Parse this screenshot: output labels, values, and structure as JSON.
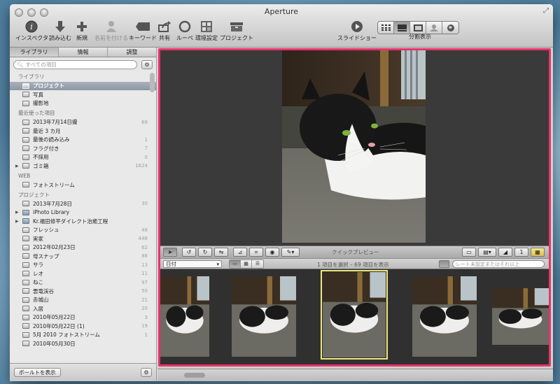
{
  "window": {
    "title": "Aperture"
  },
  "toolbar": {
    "inspector": "インスペクタ",
    "import": "読み込む",
    "new": "新規",
    "name_faces": "名前を付ける",
    "keywords": "キーワード",
    "share": "共有",
    "loupe": "ルーペ",
    "settings": "環境設定",
    "project": "プロジェクト",
    "slideshow": "スライドショー",
    "split_view": "分割表示"
  },
  "inspector": {
    "tabs": [
      "ライブラリ",
      "情報",
      "調整"
    ],
    "search_placeholder": "すべての項目",
    "sections": {
      "library": "ライブラリ",
      "recent": "最近使った項目",
      "web": "WEB",
      "projects": "プロジェクト"
    },
    "library_items": [
      {
        "label": "プロジェクト",
        "selected": true,
        "icon": "projects-icon"
      },
      {
        "label": "写真",
        "icon": "photos-icon"
      },
      {
        "label": "撮影地",
        "icon": "places-icon"
      }
    ],
    "recent_items": [
      {
        "label": "2013年7月14日撮",
        "count": "69",
        "icon": "project-icon"
      },
      {
        "label": "最近 3 カ月",
        "count": "",
        "icon": "calendar-icon"
      },
      {
        "label": "最後の読み込み",
        "count": "1",
        "icon": "import-icon"
      },
      {
        "label": "フラグ付き",
        "count": "7",
        "icon": "flag-icon"
      },
      {
        "label": "不採用",
        "count": "0",
        "icon": "reject-icon"
      },
      {
        "label": "ゴミ箱",
        "count": "1624",
        "icon": "trash-icon",
        "disclosure": true
      }
    ],
    "web_items": [
      {
        "label": "フォトストリーム",
        "icon": "photostream-icon"
      }
    ],
    "project_items": [
      {
        "label": "2013年7月28日",
        "count": "30"
      },
      {
        "label": "iPhoto Library",
        "count": "",
        "disclosure": true,
        "folder": true
      },
      {
        "label": "Kr.福田修平ダイレクト治癒工程",
        "count": "",
        "disclosure": true,
        "folder": true
      },
      {
        "label": "フレッシュ",
        "count": "48"
      },
      {
        "label": "実家",
        "count": "448"
      },
      {
        "label": "2012年02月23日",
        "count": "62"
      },
      {
        "label": "母スナップ",
        "count": "88"
      },
      {
        "label": "サラ",
        "count": "13"
      },
      {
        "label": "レオ",
        "count": "11"
      },
      {
        "label": "ねこ",
        "count": "97"
      },
      {
        "label": "雲竜渓谷",
        "count": "50"
      },
      {
        "label": "赤城山",
        "count": "21"
      },
      {
        "label": "入居",
        "count": "20"
      },
      {
        "label": "2010年05月22日",
        "count": "3"
      },
      {
        "label": "2010年05月22日 (1)",
        "count": "19"
      },
      {
        "label": "5月 2010 フォトストリーム",
        "count": "1"
      },
      {
        "label": "2010年05月30日",
        "count": ""
      }
    ],
    "show_pallet_button": "ボールトを表示"
  },
  "viewer": {
    "quick_preview": "クイックプレビュー"
  },
  "browser": {
    "sort_value": "日付",
    "selection_info": "1 項目を選択 – 69 項目を表示",
    "filter_placeholder": "レート未設定またはそれ以上",
    "selected_index": 2
  },
  "colors": {
    "highlight_frame": "#e8336b",
    "selection_yellow": "#f1e77a",
    "sidebar_selection": "#96a0ad"
  }
}
